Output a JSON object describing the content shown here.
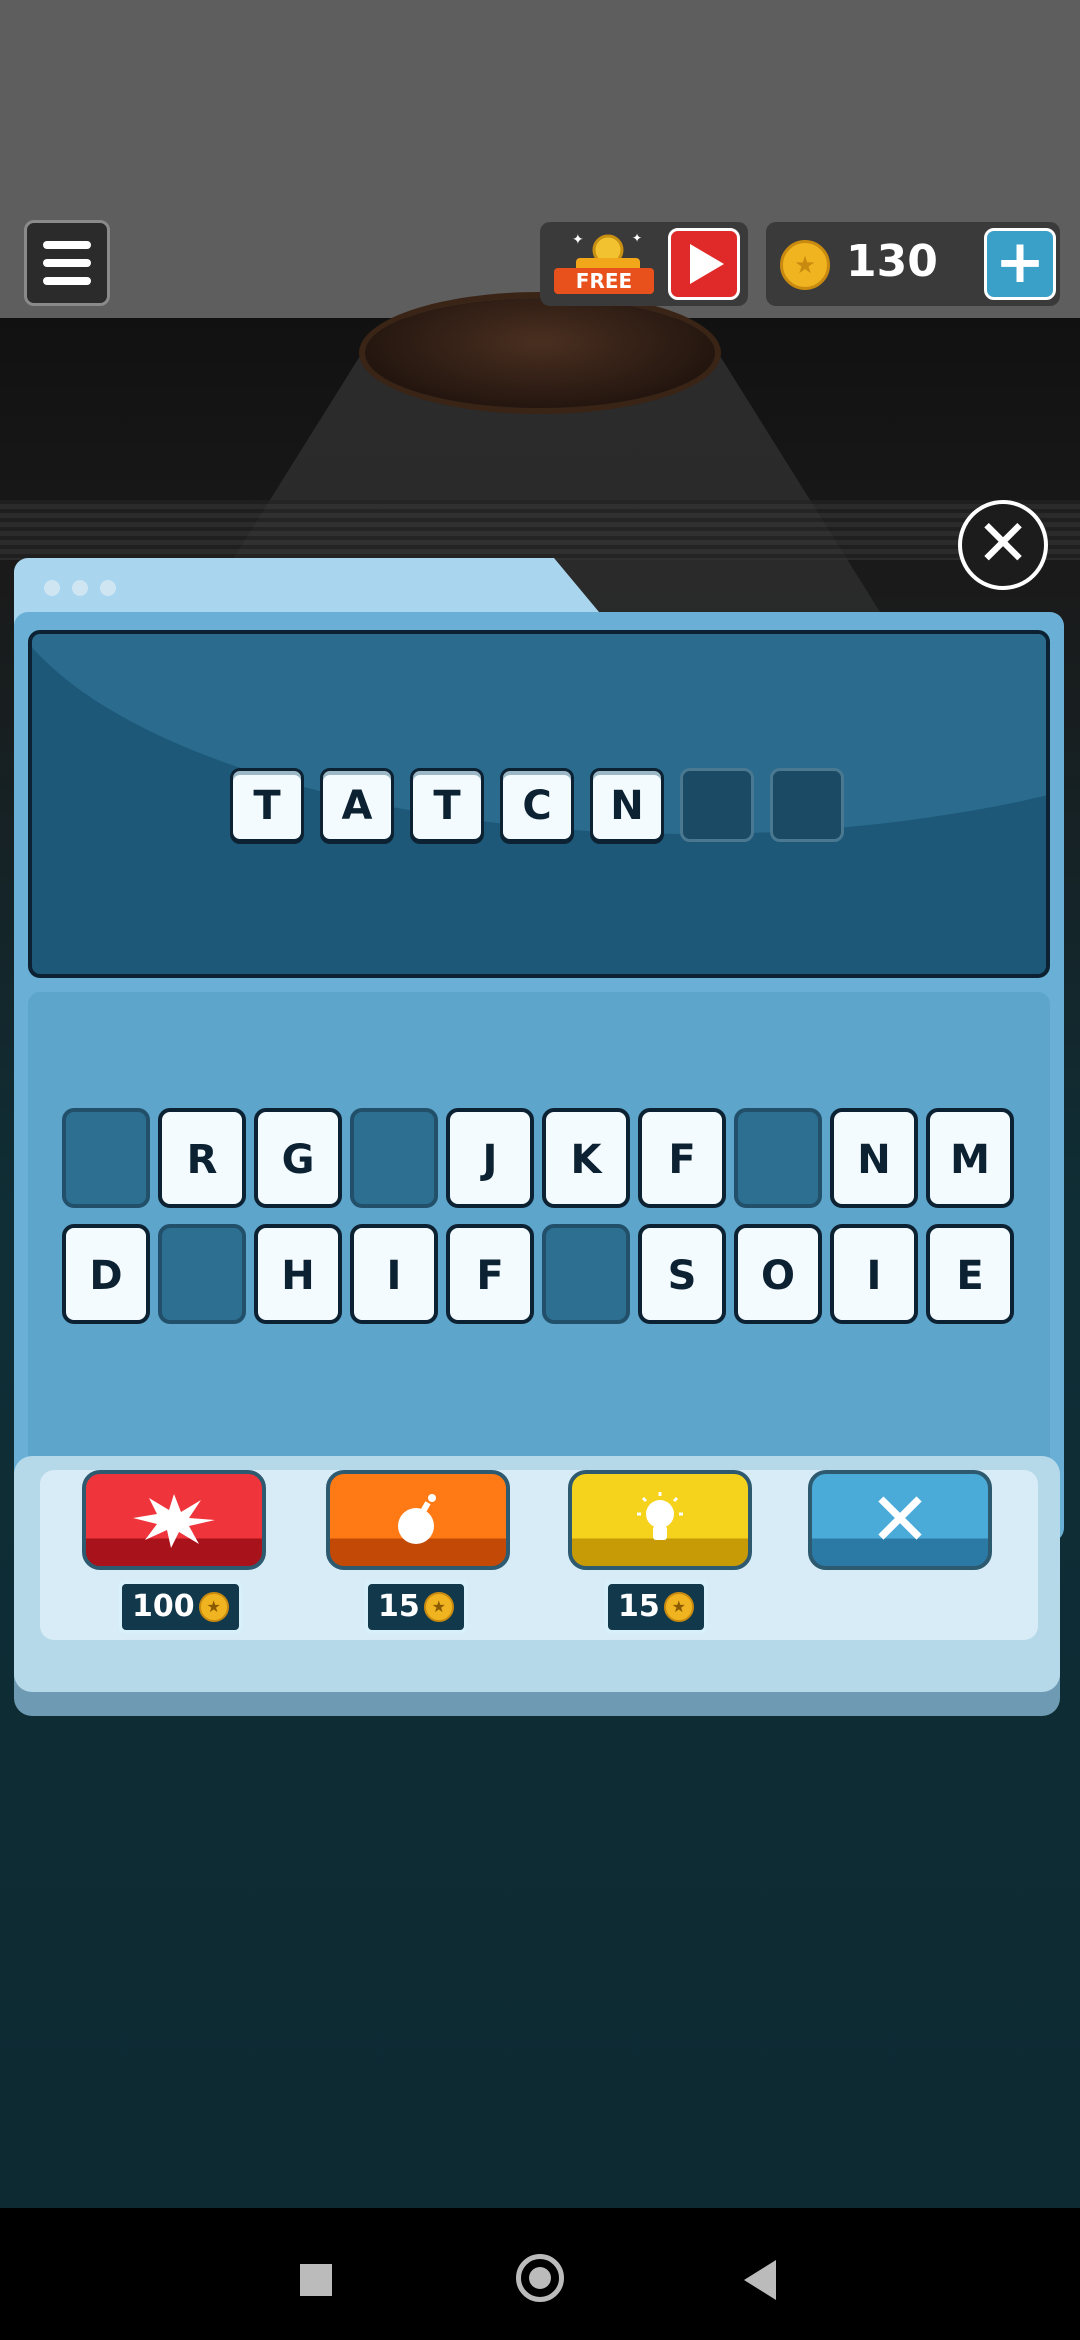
{
  "header": {
    "free_label": "FREE",
    "coins": "130",
    "plus_label": "+"
  },
  "close_label": "✕",
  "answer": {
    "letters": [
      "T",
      "A",
      "T",
      "C",
      "N",
      "",
      ""
    ]
  },
  "keyboard": {
    "row1": [
      "",
      "R",
      "G",
      "",
      "J",
      "K",
      "F",
      "",
      "N",
      "M"
    ],
    "row2": [
      "D",
      "",
      "H",
      "I",
      "F",
      "",
      "S",
      "O",
      "I",
      "E"
    ]
  },
  "powerups": {
    "blast_price": "100",
    "bomb_price": "15",
    "hint_price": "15",
    "clear_label": "✕"
  },
  "colors": {
    "accent_blue": "#3aa0c8",
    "red_button": "#f0343c",
    "orange_button": "#ff7a14",
    "yellow_button": "#f5d21c"
  }
}
